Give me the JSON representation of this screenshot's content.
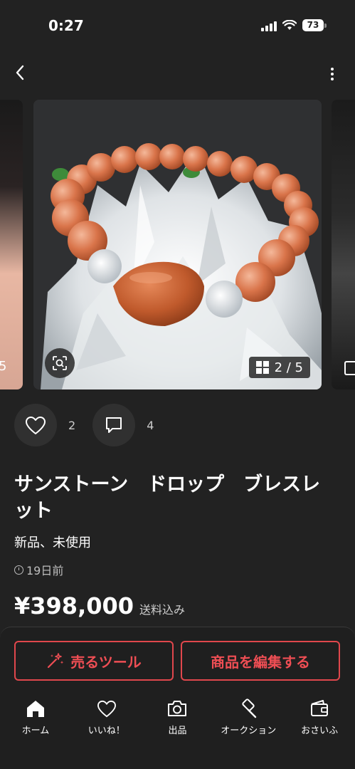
{
  "status_bar": {
    "time": "0:27",
    "battery": "73"
  },
  "nav": {
    "back_icon": "chevron-left-icon",
    "more_icon": "more-vertical-icon"
  },
  "carousel": {
    "prev_counter_fragment": "5",
    "current_counter": "2 / 5",
    "zoom_icon": "scan-icon",
    "counter_icon": "grid-icon"
  },
  "engagement": {
    "like_count": "2",
    "comment_count": "4"
  },
  "product": {
    "title": "サンストーン　ドロップ　ブレスレット",
    "condition": "新品、未使用",
    "posted": "19日前",
    "price": "¥398,000",
    "shipping": "送料込み"
  },
  "buttons": {
    "sell_tools_label": "売るツール",
    "edit_label": "商品を編集する"
  },
  "tabbar": {
    "items": [
      {
        "label": "ホーム",
        "icon": "home-icon"
      },
      {
        "label": "いいね！",
        "icon": "heart-icon"
      },
      {
        "label": "出品",
        "icon": "camera-icon"
      },
      {
        "label": "オークション",
        "icon": "gavel-icon"
      },
      {
        "label": "おさいふ",
        "icon": "wallet-icon"
      }
    ]
  },
  "colors": {
    "background": "#222222",
    "accent": "#e0474c"
  }
}
